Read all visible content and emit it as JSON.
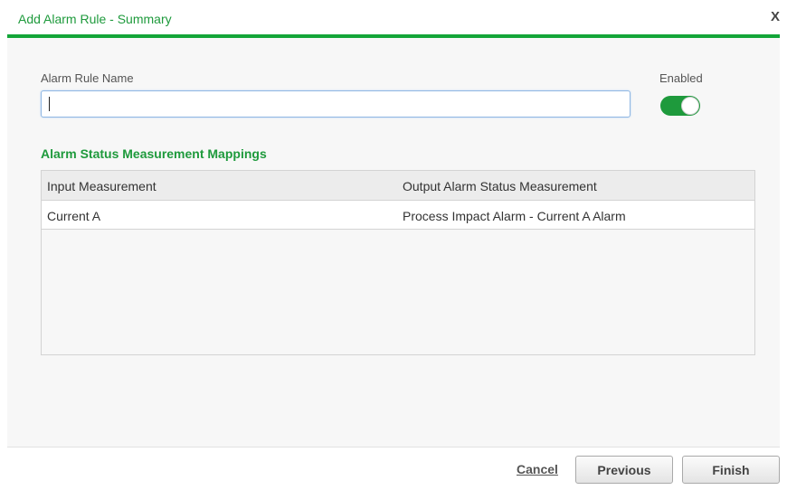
{
  "dialog": {
    "title": "Add Alarm Rule - Summary",
    "close_label": "X"
  },
  "form": {
    "name_label": "Alarm Rule Name",
    "name_value": "",
    "enabled_label": "Enabled",
    "enabled": true
  },
  "mappings": {
    "title": "Alarm Status Measurement Mappings",
    "columns": [
      "Input Measurement",
      "Output Alarm Status Measurement"
    ],
    "rows": [
      [
        "Current A",
        "Process Impact Alarm - Current A Alarm"
      ]
    ]
  },
  "footer": {
    "cancel_label": "Cancel",
    "previous_label": "Previous",
    "finish_label": "Finish"
  },
  "colors": {
    "accent": "#13a538",
    "title_green": "#1e9a3c"
  }
}
